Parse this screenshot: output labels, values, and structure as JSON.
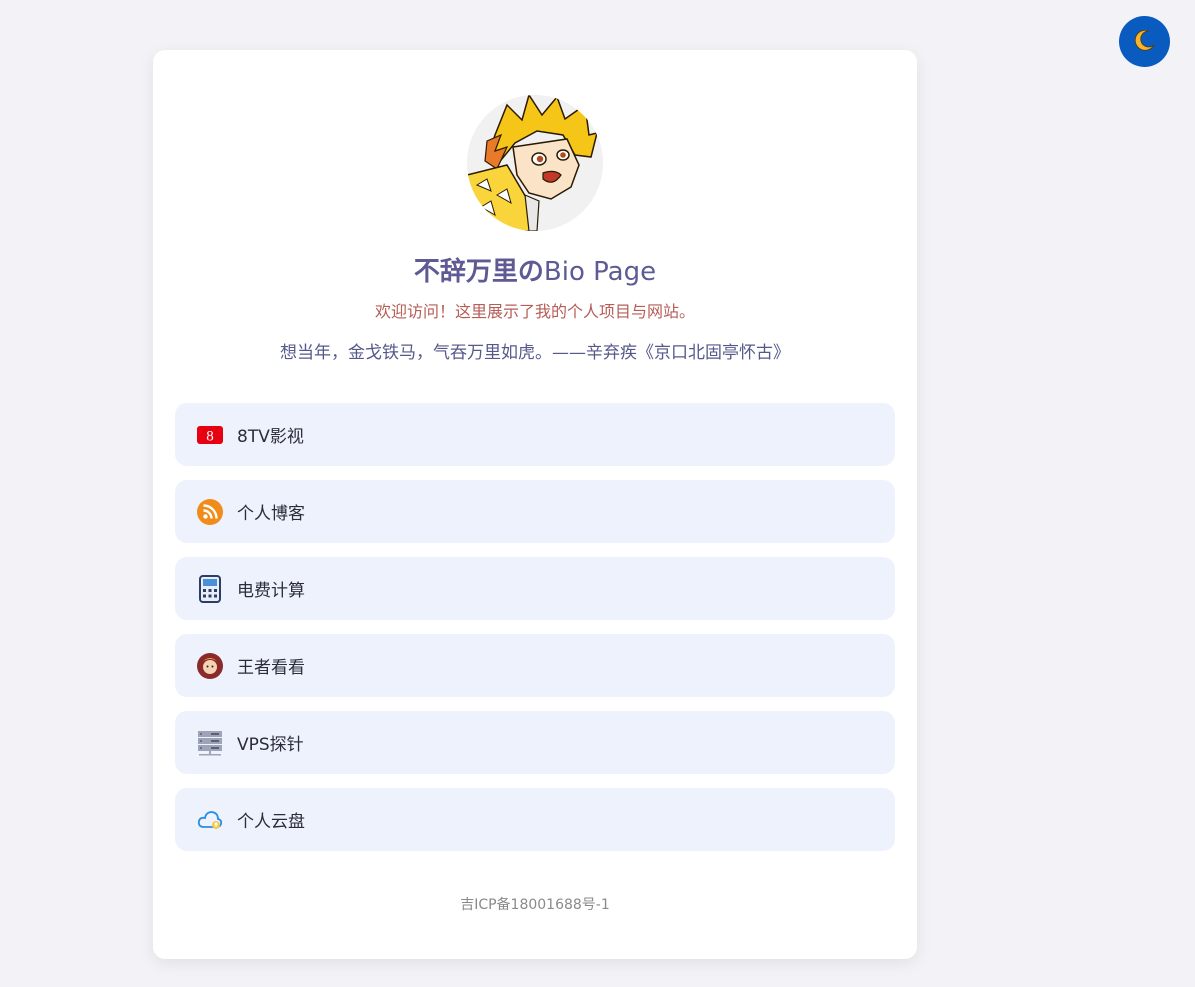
{
  "theme_toggle": {
    "icon": "moon-icon"
  },
  "profile": {
    "title_strong": "不辞万里の",
    "title_rest": "Bio Page",
    "subtitle": "欢迎访问！这里展示了我的个人项目与网站。",
    "quote": "想当年，金戈铁马，气吞万里如虎。——辛弃疾《京口北固亭怀古》"
  },
  "links": [
    {
      "label": "8TV影视",
      "icon": "8tv-icon",
      "icon_text": "8"
    },
    {
      "label": "个人博客",
      "icon": "rss-icon"
    },
    {
      "label": "电费计算",
      "icon": "calculator-icon"
    },
    {
      "label": "王者看看",
      "icon": "game-avatar-icon"
    },
    {
      "label": "VPS探针",
      "icon": "server-icon"
    },
    {
      "label": "个人云盘",
      "icon": "cloud-icon"
    }
  ],
  "footer": {
    "icp": "吉ICP备18001688号-1"
  },
  "colors": {
    "background": "#f3f3f7",
    "card": "#ffffff",
    "link_bg": "#edf2fd",
    "title": "#5e5a94",
    "subtitle": "#b65d57",
    "toggle": "#0a5bbf"
  }
}
